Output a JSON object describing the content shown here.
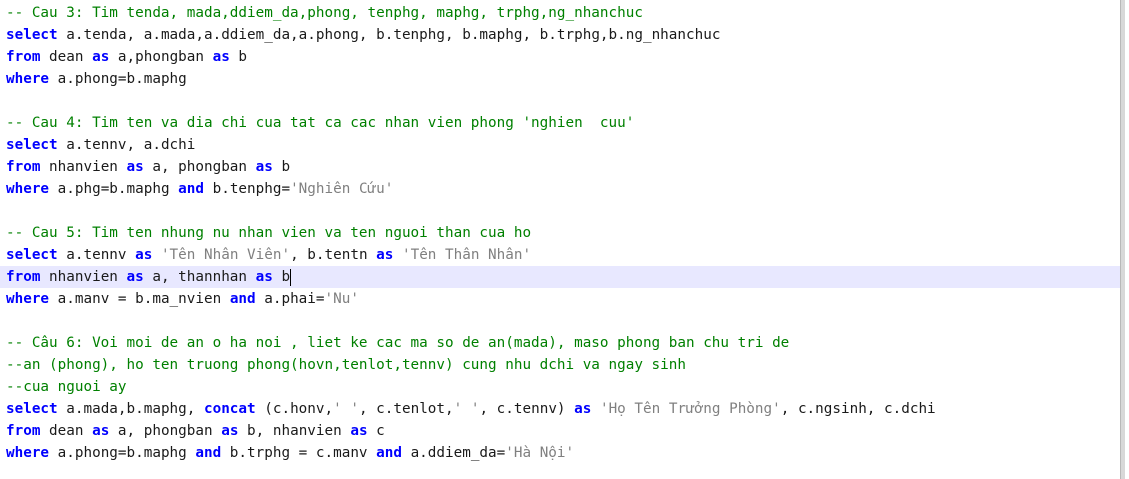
{
  "lines": [
    [
      {
        "t": "cm",
        "v": "-- Cau 3: Tim tenda, mada,ddiem_da,phong, tenphg, maphg, trphg,ng_nhanchuc"
      }
    ],
    [
      {
        "t": "kw",
        "v": "select"
      },
      {
        "t": "tx",
        "v": " a.tenda, a.mada,a.ddiem_da,a.phong, b.tenphg, b.maphg, b.trphg,b.ng_nhanchuc"
      }
    ],
    [
      {
        "t": "kw",
        "v": "from"
      },
      {
        "t": "tx",
        "v": " dean "
      },
      {
        "t": "kw",
        "v": "as"
      },
      {
        "t": "tx",
        "v": " a,phongban "
      },
      {
        "t": "kw",
        "v": "as"
      },
      {
        "t": "tx",
        "v": " b"
      }
    ],
    [
      {
        "t": "kw",
        "v": "where"
      },
      {
        "t": "tx",
        "v": " a.phong=b.maphg"
      }
    ],
    [],
    [
      {
        "t": "cm",
        "v": "-- Cau 4: Tim ten va dia chi cua tat ca cac nhan vien phong 'nghien  cuu'"
      }
    ],
    [
      {
        "t": "kw",
        "v": "select"
      },
      {
        "t": "tx",
        "v": " a.tennv, a.dchi"
      }
    ],
    [
      {
        "t": "kw",
        "v": "from"
      },
      {
        "t": "tx",
        "v": " nhanvien "
      },
      {
        "t": "kw",
        "v": "as"
      },
      {
        "t": "tx",
        "v": " a, phongban "
      },
      {
        "t": "kw",
        "v": "as"
      },
      {
        "t": "tx",
        "v": " b"
      }
    ],
    [
      {
        "t": "kw",
        "v": "where"
      },
      {
        "t": "tx",
        "v": " a.phg=b.maphg "
      },
      {
        "t": "kw",
        "v": "and"
      },
      {
        "t": "tx",
        "v": " b.tenphg="
      },
      {
        "t": "st",
        "v": "'Nghiên Cứu'"
      }
    ],
    [],
    [
      {
        "t": "cm",
        "v": "-- Cau 5: Tim ten nhung nu nhan vien va ten nguoi than cua ho"
      }
    ],
    [
      {
        "t": "kw",
        "v": "select"
      },
      {
        "t": "tx",
        "v": " a.tennv "
      },
      {
        "t": "kw",
        "v": "as"
      },
      {
        "t": "tx",
        "v": " "
      },
      {
        "t": "st",
        "v": "'Tên Nhân Viên'"
      },
      {
        "t": "tx",
        "v": ", b.tentn "
      },
      {
        "t": "kw",
        "v": "as"
      },
      {
        "t": "tx",
        "v": " "
      },
      {
        "t": "st",
        "v": "'Tên Thân Nhân'"
      }
    ],
    [
      {
        "t": "kw",
        "v": "from"
      },
      {
        "t": "tx",
        "v": " nhanvien "
      },
      {
        "t": "kw",
        "v": "as"
      },
      {
        "t": "tx",
        "v": " a, thannhan "
      },
      {
        "t": "kw",
        "v": "as"
      },
      {
        "t": "tx",
        "v": " b"
      },
      {
        "t": "caret",
        "v": ""
      }
    ],
    [
      {
        "t": "kw",
        "v": "where"
      },
      {
        "t": "tx",
        "v": " a.manv = b.ma_nvien "
      },
      {
        "t": "kw",
        "v": "and"
      },
      {
        "t": "tx",
        "v": " a.phai="
      },
      {
        "t": "st",
        "v": "'Nu'"
      }
    ],
    [],
    [
      {
        "t": "cm",
        "v": "-- Câu 6: Voi moi de an o ha noi , liet ke cac ma so de an(mada), maso phong ban chu tri de"
      }
    ],
    [
      {
        "t": "cm",
        "v": "--an (phong), ho ten truong phong(hovn,tenlot,tennv) cung nhu dchi va ngay sinh"
      }
    ],
    [
      {
        "t": "cm",
        "v": "--cua nguoi ay"
      }
    ],
    [
      {
        "t": "kw",
        "v": "select"
      },
      {
        "t": "tx",
        "v": " a.mada,b.maphg, "
      },
      {
        "t": "kw",
        "v": "concat"
      },
      {
        "t": "tx",
        "v": " (c.honv,"
      },
      {
        "t": "st",
        "v": "' '"
      },
      {
        "t": "tx",
        "v": ", c.tenlot,"
      },
      {
        "t": "st",
        "v": "' '"
      },
      {
        "t": "tx",
        "v": ", c.tennv) "
      },
      {
        "t": "kw",
        "v": "as"
      },
      {
        "t": "tx",
        "v": " "
      },
      {
        "t": "st",
        "v": "'Họ Tên Trưởng Phòng'"
      },
      {
        "t": "tx",
        "v": ", c.ngsinh, c.dchi"
      }
    ],
    [
      {
        "t": "kw",
        "v": "from"
      },
      {
        "t": "tx",
        "v": " dean "
      },
      {
        "t": "kw",
        "v": "as"
      },
      {
        "t": "tx",
        "v": " a, phongban "
      },
      {
        "t": "kw",
        "v": "as"
      },
      {
        "t": "tx",
        "v": " b, nhanvien "
      },
      {
        "t": "kw",
        "v": "as"
      },
      {
        "t": "tx",
        "v": " c"
      }
    ],
    [
      {
        "t": "kw",
        "v": "where"
      },
      {
        "t": "tx",
        "v": " a.phong=b.maphg "
      },
      {
        "t": "kw",
        "v": "and"
      },
      {
        "t": "tx",
        "v": " b.trphg = c.manv "
      },
      {
        "t": "kw",
        "v": "and"
      },
      {
        "t": "tx",
        "v": " a.ddiem_da="
      },
      {
        "t": "st",
        "v": "'Hà Nội'"
      }
    ]
  ]
}
